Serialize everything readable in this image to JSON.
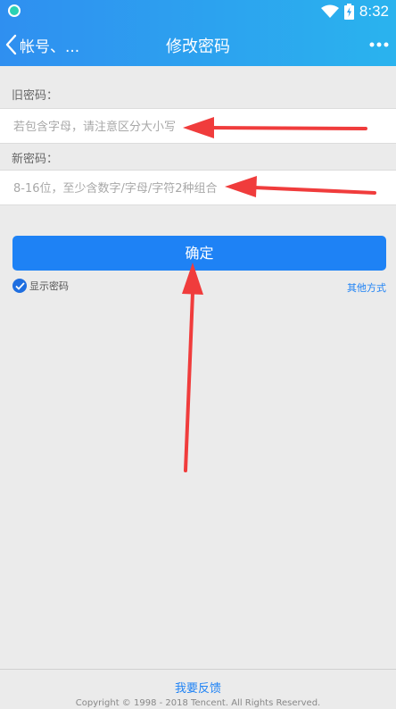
{
  "status_bar": {
    "time": "8:32"
  },
  "nav": {
    "back_label": "帐号、...",
    "title": "修改密码"
  },
  "old_password": {
    "label": "旧密码：",
    "placeholder": "若包含字母，请注意区分大小写"
  },
  "new_password": {
    "label": "新密码：",
    "placeholder": "8-16位，至少含数字/字母/字符2种组合"
  },
  "confirm_button": {
    "label": "确定"
  },
  "show_password": {
    "label": "显示密码",
    "checked": true
  },
  "other_methods": {
    "label": "其他方式"
  },
  "footer": {
    "feedback": "我要反馈",
    "copyright": "Copyright © 1998 - 2018 Tencent. All Rights Reserved."
  },
  "colors": {
    "header_start": "#2f8ff0",
    "header_end": "#2ab3ee",
    "primary": "#1e82f5",
    "annotation_arrow": "#f03c3c",
    "background": "#ebebeb"
  },
  "icons": {
    "status_app": "app-notification-icon",
    "wifi": "wifi-icon",
    "battery": "battery-charging-icon",
    "back": "chevron-left-icon",
    "more": "more-dots-icon",
    "check": "check-icon"
  }
}
